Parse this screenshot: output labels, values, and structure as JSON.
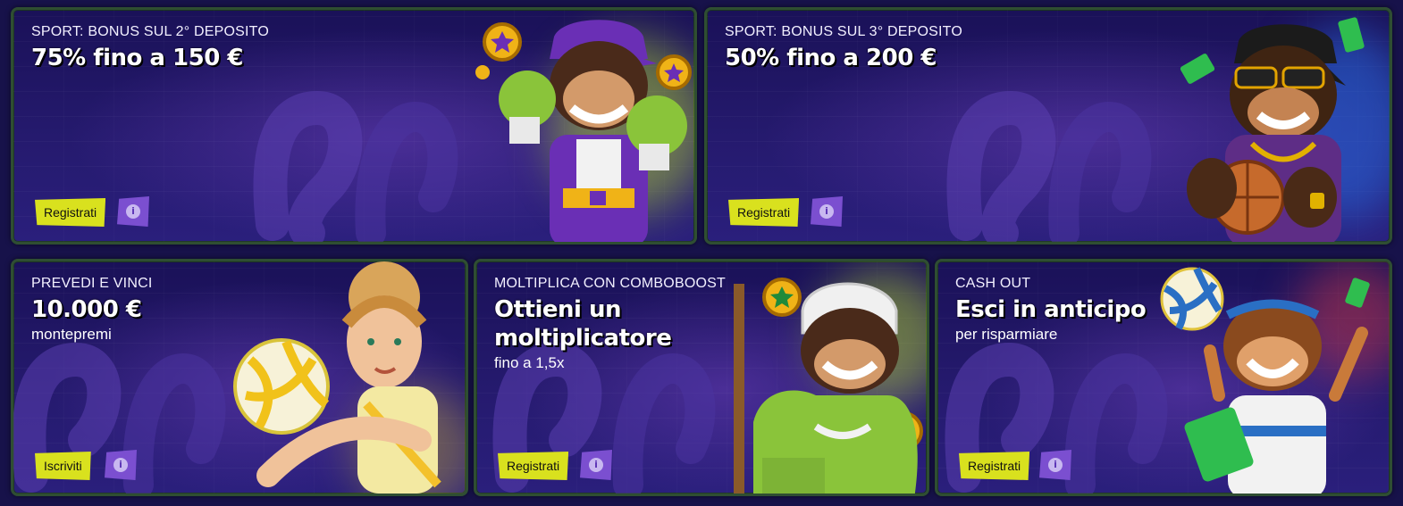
{
  "cards": [
    {
      "subtitle": "SPORT: BONUS SUL 2° DEPOSITO",
      "headline": "75% fino a 150 €",
      "button": "Registrati",
      "info_icon": "info-icon",
      "art": "boxing-gorilla"
    },
    {
      "subtitle": "SPORT: BONUS SUL 3° DEPOSITO",
      "headline": "50% fino a 200 €",
      "button": "Registrati",
      "info_icon": "info-icon",
      "art": "basketball-gorilla"
    },
    {
      "subtitle": "PREVEDI E VINCI",
      "headline": "10.000 €",
      "caption": "montepremi",
      "button": "Iscriviti",
      "info_icon": "info-icon",
      "art": "volleyball-player"
    },
    {
      "subtitle": "MOLTIPLICA CON COMBOBOOST",
      "headline_line1": "Ottieni un",
      "headline_line2": "moltiplicatore",
      "caption": "fino a 1,5x",
      "button": "Registrati",
      "info_icon": "info-icon",
      "art": "hockey-gorilla"
    },
    {
      "subtitle": "CASH OUT",
      "headline": "Esci in anticipo",
      "caption": "per risparmiare",
      "button": "Registrati",
      "info_icon": "info-icon",
      "art": "cashout-gorilla"
    }
  ],
  "colors": {
    "background": "#17124a",
    "card_border": "#2f4e32",
    "button": "#d9e11e",
    "info_button": "#7b4fd0"
  }
}
